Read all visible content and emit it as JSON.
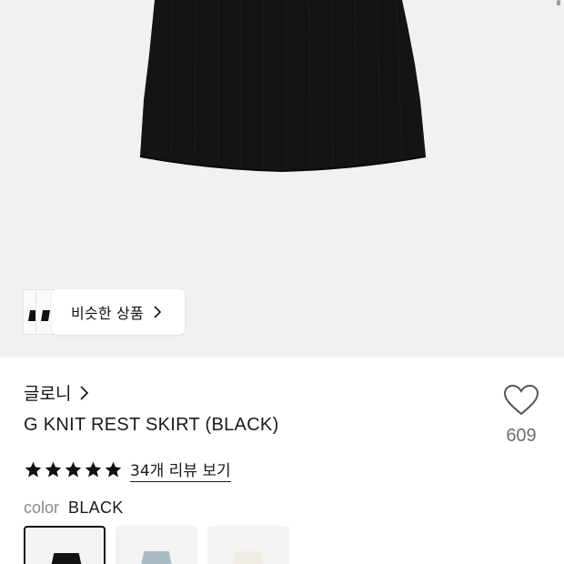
{
  "similar": {
    "label": "비슷한 상품"
  },
  "product": {
    "brand": "글로니",
    "name": "G KNIT REST SKIRT (BLACK)",
    "wish_count": "609",
    "rating": 5,
    "reviews_label": "34개 리뷰 보기",
    "color_label": "color",
    "color_value": "BLACK"
  },
  "swatches": [
    {
      "color": "#111111",
      "bg": "#f5f5f5",
      "selected": true
    },
    {
      "color": "#a9bcc6",
      "bg": "#f1f1f1",
      "selected": false
    },
    {
      "color": "#f0ece4",
      "bg": "#f5f5f3",
      "selected": false
    }
  ],
  "icons": {
    "chevron": "chevron-right-icon",
    "heart": "heart-outline-icon",
    "star": "star-filled-icon"
  },
  "colors": {
    "hero_bg": "#f1f1f1",
    "skirt": "#141414",
    "star": "#111111",
    "count_gray": "#6e6e6e"
  }
}
